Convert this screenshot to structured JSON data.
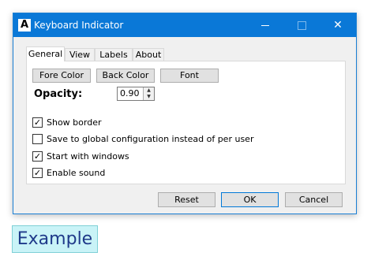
{
  "window": {
    "title": "Keyboard Indicator",
    "icon": "keyboard-indicator-app-icon",
    "icon_glyph": "A",
    "controls": {
      "minimize": "minimize-icon",
      "maximize": "maximize-icon",
      "close": "close-icon",
      "close_glyph": "✕"
    }
  },
  "tabs": [
    {
      "label": "General",
      "active": true
    },
    {
      "label": "View",
      "active": false
    },
    {
      "label": "Labels",
      "active": false
    },
    {
      "label": "About",
      "active": false
    }
  ],
  "general": {
    "buttons": {
      "fore_color": "Fore Color",
      "back_color": "Back Color",
      "font": "Font"
    },
    "opacity": {
      "label": "Opacity:",
      "value": "0.90"
    },
    "options": [
      {
        "label": "Show border",
        "checked": true
      },
      {
        "label": "Save to global configuration instead of per user",
        "checked": false
      },
      {
        "label": "Start with windows",
        "checked": true
      },
      {
        "label": "Enable sound",
        "checked": true
      }
    ]
  },
  "footer": {
    "reset": "Reset",
    "ok": "OK",
    "cancel": "Cancel"
  },
  "caption": {
    "text": "Example"
  },
  "colors": {
    "titlebar": "#0a78d7",
    "caption_bg": "#c9f3f7",
    "caption_text": "#1f3a8a"
  }
}
